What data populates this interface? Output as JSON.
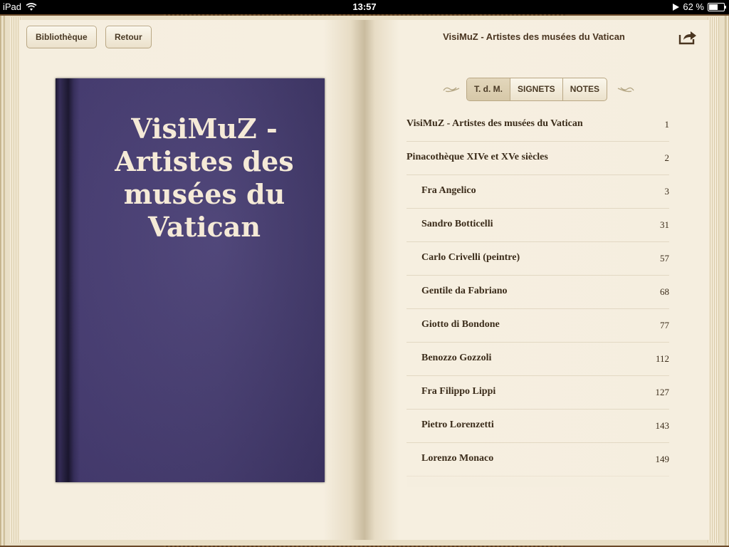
{
  "status_bar": {
    "device": "iPad",
    "time": "13:57",
    "battery": "62 %",
    "battery_level": 0.62
  },
  "toolbar": {
    "library_label": "Bibliothèque",
    "back_label": "Retour"
  },
  "cover": {
    "title_lines": [
      "VisiMuZ -",
      "Artistes des",
      "musées du",
      "Vatican"
    ],
    "color": "#463c72"
  },
  "header": {
    "title": "VisiMuZ - Artistes des musées du Vatican"
  },
  "tabs": [
    {
      "label": "T. d. M.",
      "active": true
    },
    {
      "label": "SIGNETS",
      "active": false
    },
    {
      "label": "NOTES",
      "active": false
    }
  ],
  "toc": [
    {
      "label": "VisiMuZ - Artistes des musées du Vatican",
      "page": "1",
      "indent": 0
    },
    {
      "label": "Pinacothèque XIVe et XVe siècles",
      "page": "2",
      "indent": 0
    },
    {
      "label": "Fra Angelico",
      "page": "3",
      "indent": 1
    },
    {
      "label": "Sandro Botticelli",
      "page": "31",
      "indent": 1
    },
    {
      "label": "Carlo Crivelli (peintre)",
      "page": "57",
      "indent": 1
    },
    {
      "label": "Gentile da Fabriano",
      "page": "68",
      "indent": 1
    },
    {
      "label": "Giotto di Bondone",
      "page": "77",
      "indent": 1
    },
    {
      "label": "Benozzo Gozzoli",
      "page": "112",
      "indent": 1
    },
    {
      "label": "Fra Filippo Lippi",
      "page": "127",
      "indent": 1
    },
    {
      "label": "Pietro Lorenzetti",
      "page": "143",
      "indent": 1
    },
    {
      "label": "Lorenzo Monaco",
      "page": "149",
      "indent": 1
    }
  ],
  "icons": {
    "wifi": "wifi-icon",
    "play": "play-icon",
    "battery": "battery-icon",
    "share": "share-icon",
    "flourish": "flourish-icon"
  }
}
